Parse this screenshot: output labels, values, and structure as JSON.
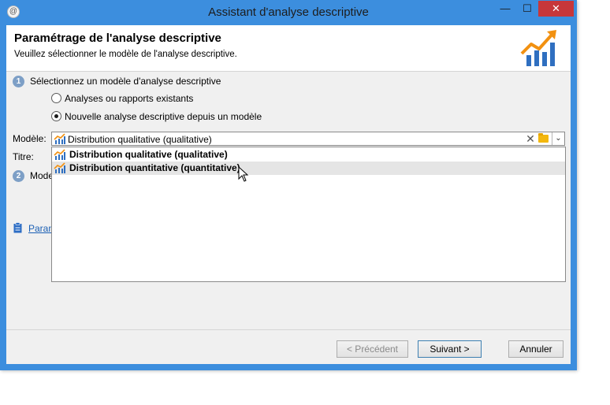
{
  "window": {
    "title": "Assistant d'analyse descriptive",
    "minimize_glyph": "—",
    "maximize_glyph": "☐",
    "close_glyph": "✕",
    "app_icon_glyph": "@"
  },
  "header": {
    "title": "Paramétrage de l'analyse descriptive",
    "subtitle": "Veuillez sélectionner le modèle de l'analyse descriptive.",
    "logo_icon": "chart-growth-icon"
  },
  "step1": {
    "number": "1",
    "label": "Sélectionnez un modèle d'analyse descriptive",
    "options": [
      {
        "label": "Analyses ou rapports existants",
        "checked": false
      },
      {
        "label": "Nouvelle analyse descriptive depuis un modèle",
        "checked": true
      }
    ]
  },
  "fields": {
    "model_label": "Modèle:",
    "title_label": "Titre:"
  },
  "model_combo": {
    "value": "Distribution qualitative (qualitative)",
    "clear_glyph": "✕",
    "arrow_glyph": "⌄"
  },
  "dropdown": {
    "items": [
      {
        "label": "Distribution qualitative (qualitative)",
        "hovered": false
      },
      {
        "label": "Distribution quantitative (quantitative)",
        "hovered": true
      }
    ]
  },
  "step2": {
    "number": "2",
    "label": "Mode"
  },
  "link": {
    "label": "Param"
  },
  "buttons": {
    "prev": "< Précédent",
    "next": "Suivant >",
    "cancel": "Annuler"
  },
  "colors": {
    "titlebar": "#3c8ede",
    "close": "#c7373a",
    "chart_orange": "#f29111",
    "chart_blue": "#2f6fc0"
  }
}
